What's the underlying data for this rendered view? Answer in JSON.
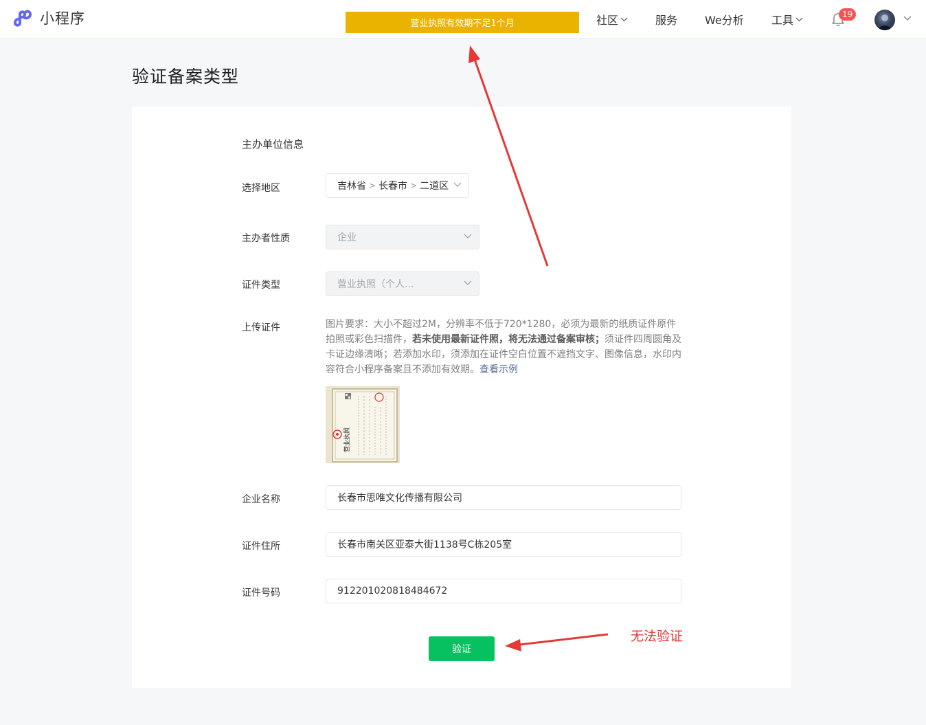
{
  "app": {
    "title": "小程序"
  },
  "banner": {
    "text": "营业执照有效期不足1个月"
  },
  "nav": {
    "community": "社区",
    "services": "服务",
    "analytics": "We分析",
    "tools": "工具",
    "notification_count": "19"
  },
  "page": {
    "title": "验证备案类型"
  },
  "form": {
    "section_title": "主办单位信息",
    "region": {
      "label": "选择地区",
      "province": "吉林省",
      "city": "长春市",
      "district": "二道区",
      "separator": ">"
    },
    "nature": {
      "label": "主办者性质",
      "value": "企业"
    },
    "cert_type": {
      "label": "证件类型",
      "value": "营业执照（个人..."
    },
    "upload": {
      "label": "上传证件",
      "req_part1": "图片要求：大小不超过2M，分辨率不低于720*1280，必须为最新的纸质证件原件拍照或彩色扫描件，",
      "req_bold": "若未使用最新证件照，将无法通过备案审核；",
      "req_part2": "须证件四周圆角及卡证边缘清晰；若添加水印，须添加在证件空白位置不遮挡文字、图像信息，水印内容符合小程序备案且不添加有效期。",
      "example_link": "查看示例",
      "thumb_text": "营业执照"
    },
    "company_name": {
      "label": "企业名称",
      "value": "长春市思唯文化传播有限公司"
    },
    "address": {
      "label": "证件住所",
      "value": "长春市南关区亚泰大街1138号C栋205室"
    },
    "cert_number": {
      "label": "证件号码",
      "value": "912201020818484672"
    },
    "verify_button": "验证"
  },
  "annotation": {
    "text": "无法验证",
    "color": "#e53935"
  },
  "colors": {
    "primary": "#07c160",
    "banner": "#eab300",
    "brand": "#6467f0",
    "badge": "#fa5151",
    "link": "#576b95"
  }
}
